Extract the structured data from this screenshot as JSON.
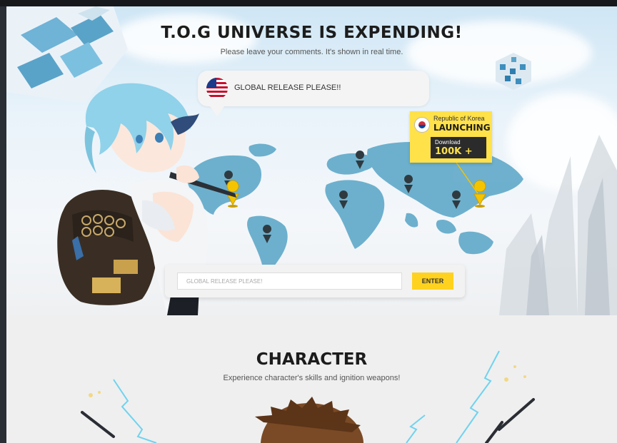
{
  "hero": {
    "title": "T.O.G UNIVERSE IS EXPENDING!",
    "subtitle": "Please leave your comments. It's shown in real time.",
    "bubble": {
      "flag_icon": "us-flag-icon",
      "text": "GLOBAL RELEASE PLEASE!!"
    },
    "launch_badge": {
      "flag_icon": "kr-flag-icon",
      "country": "Republic of Korea",
      "status": "LAUNCHING",
      "download_label": "Download",
      "download_count": "100K +"
    },
    "map": {
      "pin_icon": "map-pin-icon",
      "pin_color": "#2f3a40",
      "active_pin_color": "#f5c400"
    },
    "comment": {
      "placeholder": "GLOBAL RELEASE PLEASE!",
      "enter_label": "ENTER"
    }
  },
  "character_section": {
    "title": "CHARACTER",
    "subtitle": "Experience character's skills and ignition weapons!"
  },
  "colors": {
    "accent": "#ffd21f",
    "badge_yellow": "#ffe14a",
    "map_blue": "#5aa8c8",
    "title_text": "#1c1c1c"
  }
}
